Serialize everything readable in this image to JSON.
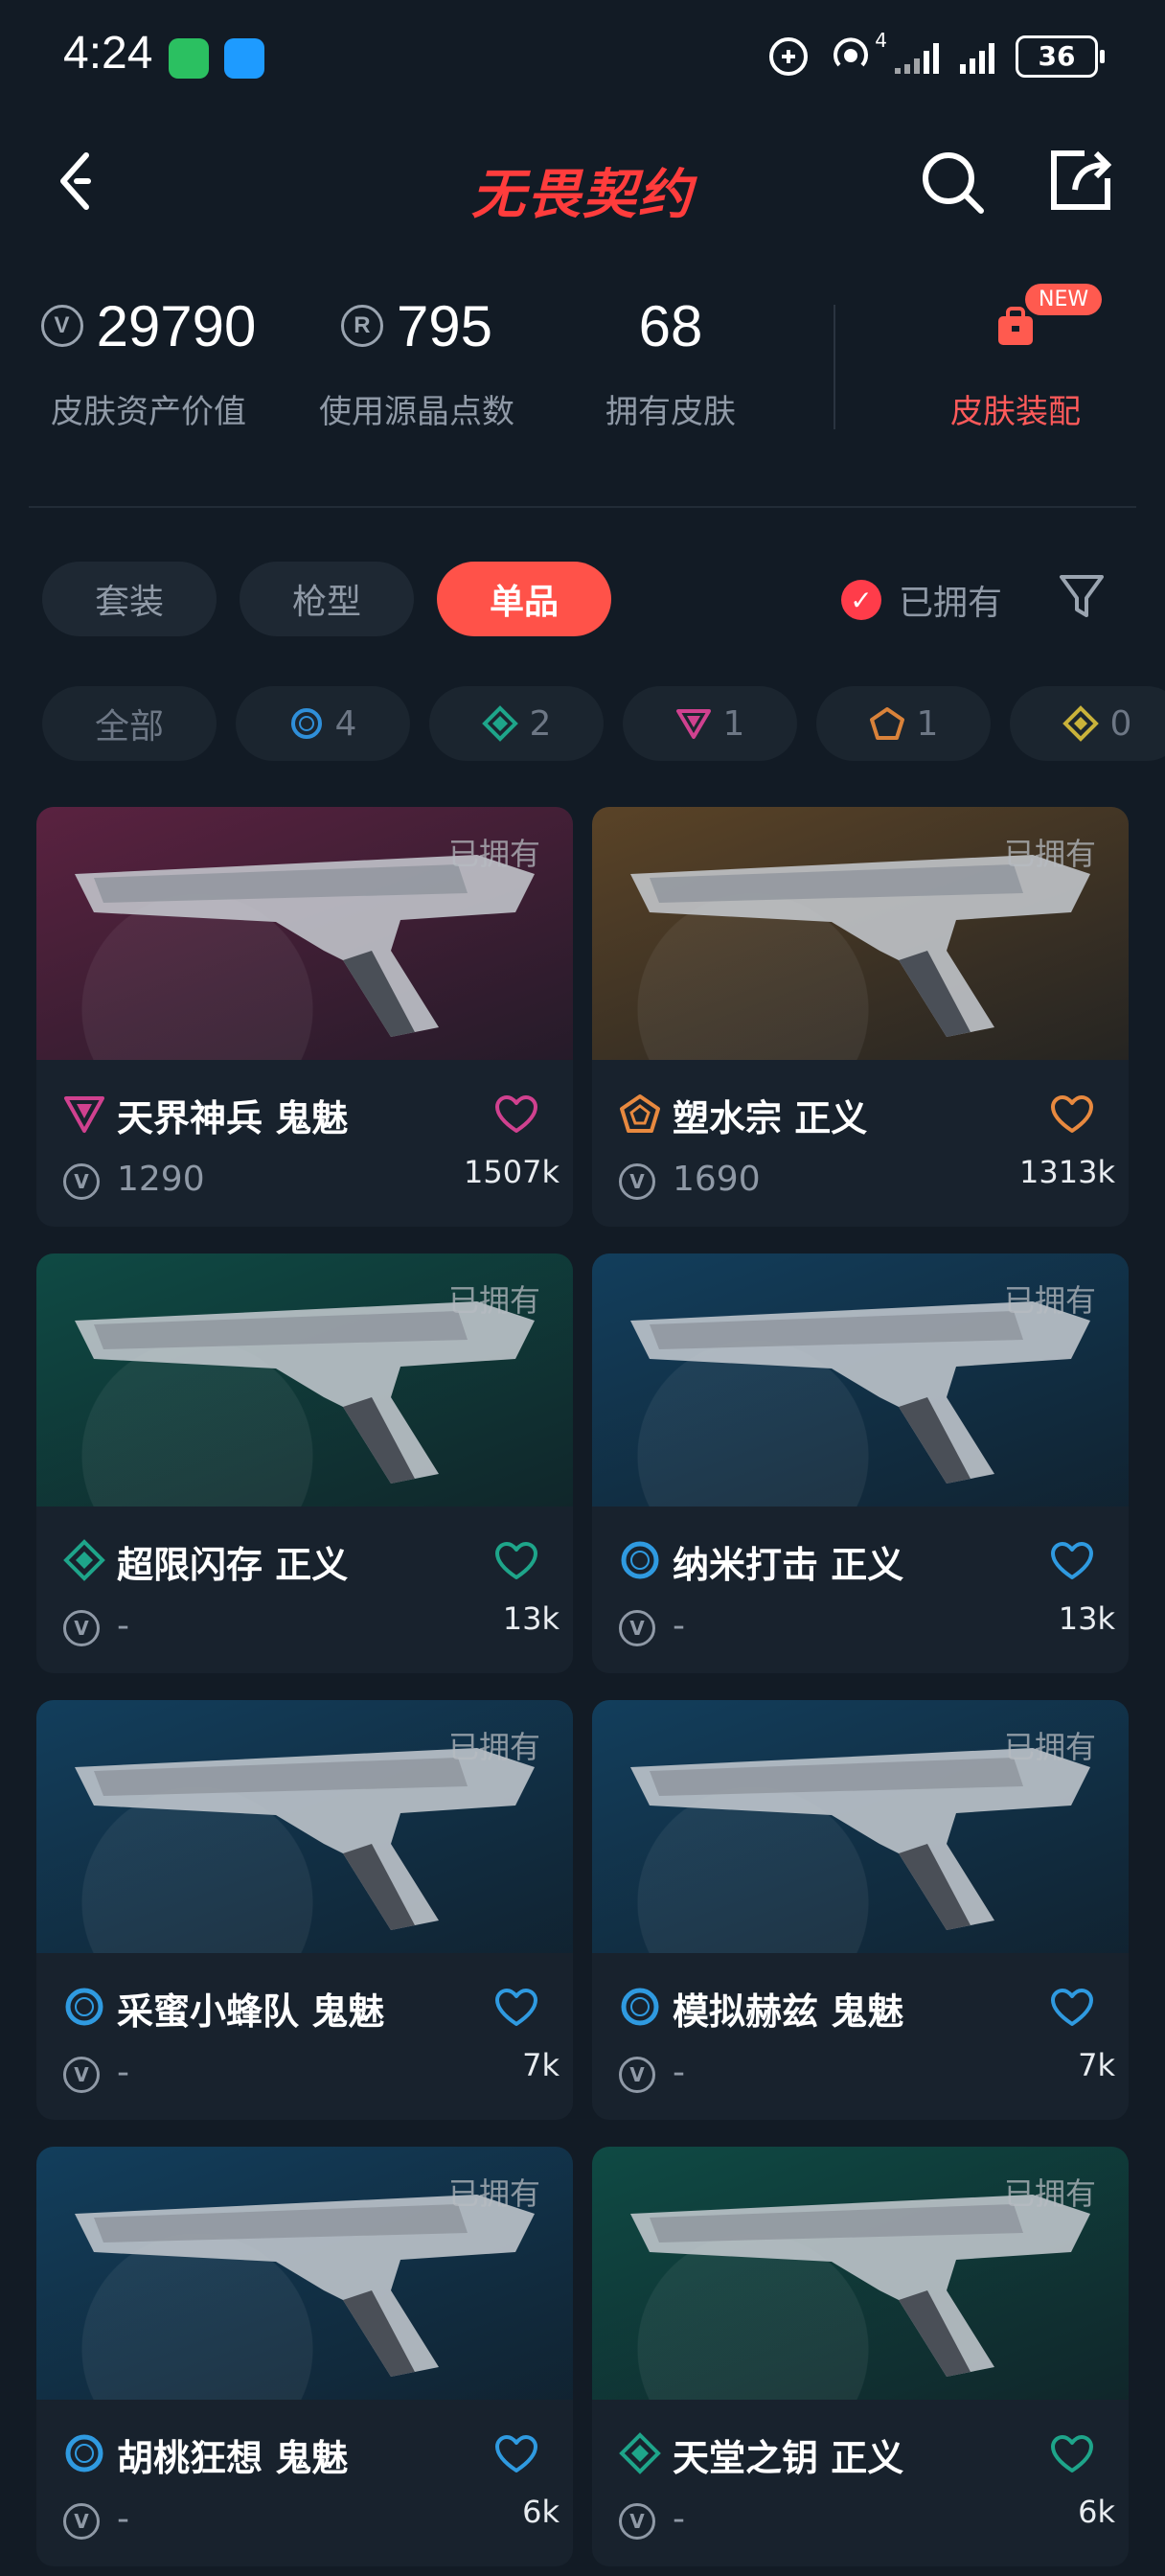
{
  "status_bar": {
    "time": "4:24",
    "network": "4",
    "battery": "36"
  },
  "header": {
    "title": "无畏契约"
  },
  "stats": [
    {
      "value": "29790",
      "label": "皮肤资产价值",
      "icon": "vp-coin-icon"
    },
    {
      "value": "795",
      "label": "使用源晶点数",
      "icon": "radianite-icon"
    },
    {
      "value": "68",
      "label": "拥有皮肤"
    }
  ],
  "outfit": {
    "label": "皮肤装配",
    "badge": "NEW"
  },
  "tabs": [
    {
      "label": "套装",
      "active": false
    },
    {
      "label": "枪型",
      "active": false
    },
    {
      "label": "单品",
      "active": true
    }
  ],
  "owned_filter": {
    "label": "已拥有",
    "checked": true
  },
  "rarity_chips": [
    {
      "label": "全部"
    },
    {
      "label": "4",
      "icon": "select-tier-icon",
      "color": "#2f8fd9"
    },
    {
      "label": "2",
      "icon": "deluxe-tier-icon",
      "color": "#1ea58a"
    },
    {
      "label": "1",
      "icon": "premium-tier-icon",
      "color": "#d0418f"
    },
    {
      "label": "1",
      "icon": "exclusive-tier-icon",
      "color": "#d9823a"
    },
    {
      "label": "0",
      "icon": "ultra-tier-icon",
      "color": "#c9b23a"
    }
  ],
  "skins": [
    {
      "name": "天界神兵 鬼魅",
      "price": "1290",
      "likes": "1507k",
      "owned": "已拥有",
      "tier_color": "#d0418f",
      "tier_icon": "premium-tier-icon",
      "bg": "#5a2240"
    },
    {
      "name": "塑水宗 正义",
      "price": "1690",
      "likes": "1313k",
      "owned": "已拥有",
      "tier_color": "#e8893f",
      "tier_icon": "exclusive-tier-icon",
      "bg": "#5a4327"
    },
    {
      "name": "超限闪存 正义",
      "price": "-",
      "likes": "13k",
      "owned": "已拥有",
      "tier_color": "#1ea58a",
      "tier_icon": "deluxe-tier-icon",
      "bg": "#0f4a44"
    },
    {
      "name": "纳米打击 正义",
      "price": "-",
      "likes": "13k",
      "owned": "已拥有",
      "tier_color": "#2f9ae0",
      "tier_icon": "select-tier-icon",
      "bg": "#123e5c"
    },
    {
      "name": "采蜜小蜂队 鬼魅",
      "price": "-",
      "likes": "7k",
      "owned": "已拥有",
      "tier_color": "#2f9ae0",
      "tier_icon": "select-tier-icon",
      "bg": "#123e5c"
    },
    {
      "name": "模拟赫兹 鬼魅",
      "price": "-",
      "likes": "7k",
      "owned": "已拥有",
      "tier_color": "#2f9ae0",
      "tier_icon": "select-tier-icon",
      "bg": "#123e5c"
    },
    {
      "name": "胡桃狂想 鬼魅",
      "price": "-",
      "likes": "6k",
      "owned": "已拥有",
      "tier_color": "#2f9ae0",
      "tier_icon": "select-tier-icon",
      "bg": "#123e5c"
    },
    {
      "name": "天堂之钥 正义",
      "price": "-",
      "likes": "6k",
      "owned": "已拥有",
      "tier_color": "#1ea58a",
      "tier_icon": "deluxe-tier-icon",
      "bg": "#0f4a44"
    }
  ]
}
